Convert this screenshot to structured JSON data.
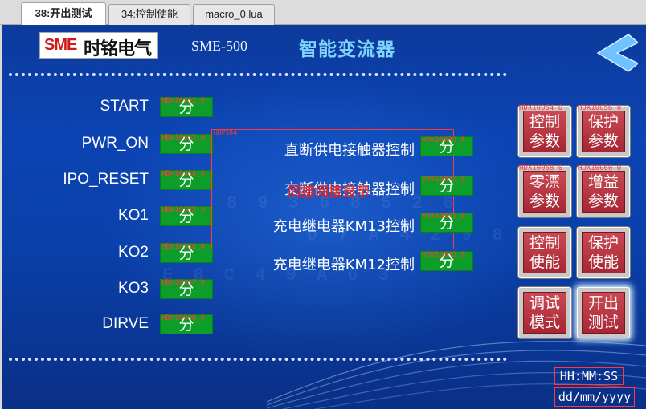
{
  "tabs": [
    {
      "label": "38:开出测试",
      "active": true
    },
    {
      "label": "34:控制使能",
      "active": false
    },
    {
      "label": "macro_0.lua",
      "active": false
    }
  ],
  "header": {
    "logo_brand": "SME",
    "logo_cn": "时铭电气",
    "model": "SME-500",
    "title": "智能变流器",
    "back_icon": "chevron-left-icon"
  },
  "left_signals": [
    {
      "label": "START",
      "tag": "HDX10032_0",
      "state": "分"
    },
    {
      "label": "PWR_ON",
      "tag": "HDX10033_0",
      "state": "分"
    },
    {
      "label": "IPO_RESET",
      "tag": "HDX10034_0",
      "state": "分"
    },
    {
      "label": "KO1",
      "tag": "HDX10035_0",
      "state": "分"
    },
    {
      "label": "KO2",
      "tag": "HDX10036_0",
      "state": "分"
    },
    {
      "label": "KO3",
      "tag": "HDX10037_0",
      "state": "分"
    },
    {
      "label": "DIRVE",
      "tag": "HDX10038_0",
      "state": "分"
    }
  ],
  "group": {
    "tag": "HDP504",
    "overlay": "间接间接显示"
  },
  "mid_signals": [
    {
      "label": "直断供电接触器控制",
      "tag": "HDX10039_0",
      "state": "分"
    },
    {
      "label": "交断供电接触器控制",
      "tag": "HDX10040_0",
      "state": "分"
    },
    {
      "label": "充电继电器KM13控制",
      "tag": "HDX10041_0",
      "state": "分"
    },
    {
      "label": "充电继电器KM12控制",
      "tag": "HDX10042_0",
      "state": "分"
    }
  ],
  "panel_buttons": [
    {
      "line1": "控制",
      "line2": "参数",
      "tag": "HDX10054_0"
    },
    {
      "line1": "保护",
      "line2": "参数",
      "tag": "HDX10056_0"
    },
    {
      "line1": "零漂",
      "line2": "参数",
      "tag": "HDX10058_0"
    },
    {
      "line1": "增益",
      "line2": "参数",
      "tag": "HDX10060_0"
    },
    {
      "line1": "控制",
      "line2": "使能",
      "tag": ""
    },
    {
      "line1": "保护",
      "line2": "使能",
      "tag": ""
    },
    {
      "line1": "调试",
      "line2": "模式",
      "tag": ""
    },
    {
      "line1": "开出",
      "line2": "测试",
      "tag": ""
    }
  ],
  "clock": {
    "time": "HH:MM:SS",
    "date": "dd/mm/yyyy"
  },
  "colors": {
    "indicator": "#0d9e2a",
    "button": "#b7303d",
    "tag": "#ff3a3a",
    "title": "#7fd3ff"
  }
}
